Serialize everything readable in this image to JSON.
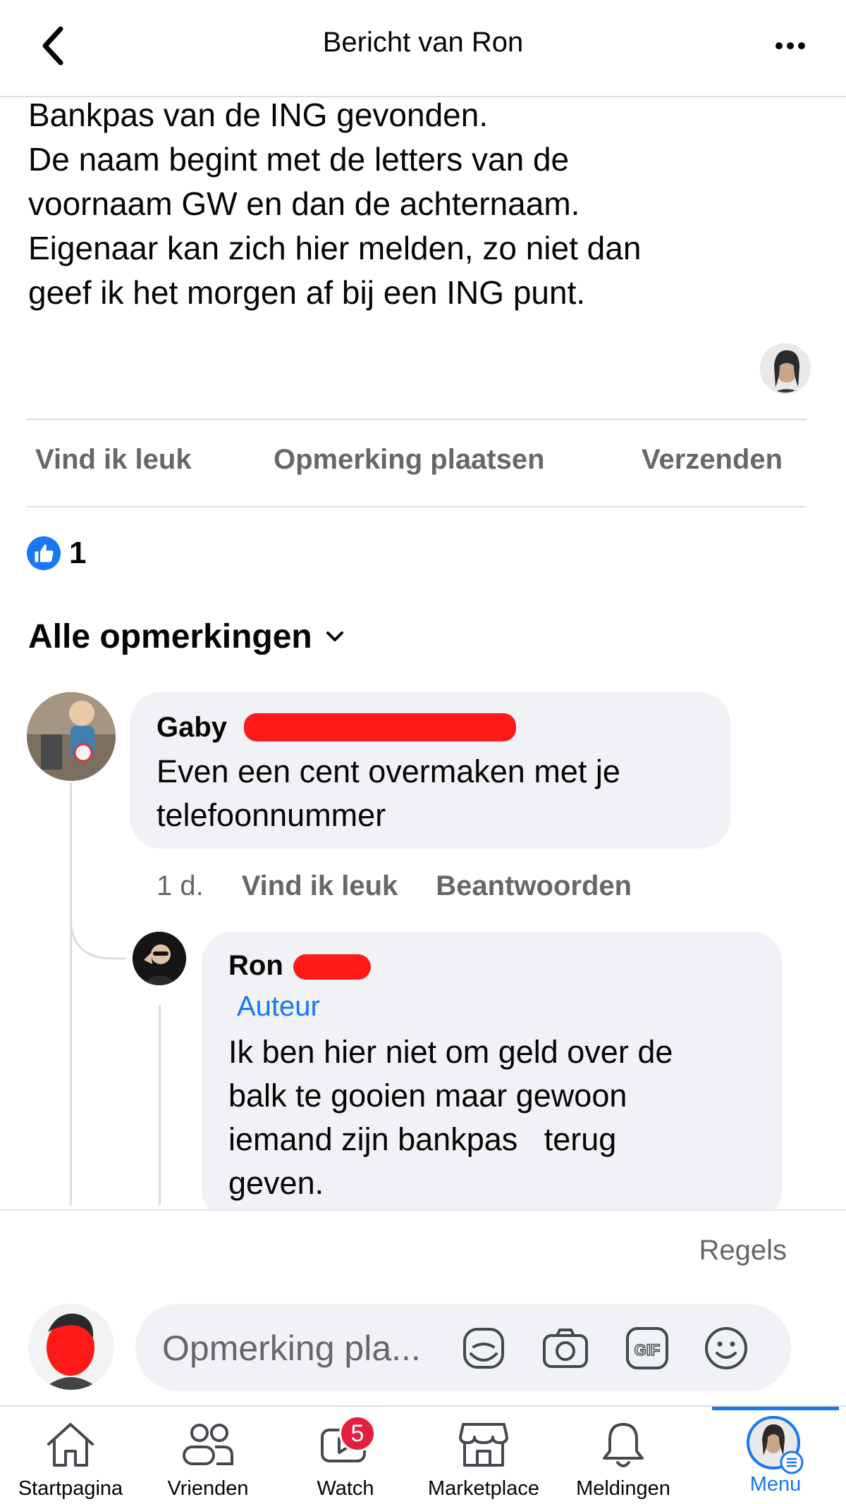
{
  "header": {
    "title": "Bericht van Ron"
  },
  "post": {
    "lines": [
      "Bankpas van de ING gevonden.",
      "De naam begint met de letters van de",
      "voornaam GW en dan de achternaam.",
      "Eigenaar kan zich hier melden, zo niet dan",
      "geef ik het morgen af bij een ING punt."
    ]
  },
  "actions": {
    "like": "Vind ik leuk",
    "comment": "Opmerking plaatsen",
    "share": "Verzenden"
  },
  "reactions": {
    "count": "1"
  },
  "comments_filter": {
    "label": "Alle opmerkingen"
  },
  "comments": [
    {
      "author": "Gaby",
      "text_lines": [
        "Even een cent overmaken met je",
        "telefoonnummer"
      ],
      "time": "1 d.",
      "like": "Vind ik leuk",
      "reply": "Beantwoorden"
    },
    {
      "author": "Ron",
      "badge": "Auteur",
      "text_lines": [
        "Ik ben hier niet om geld over de",
        "balk te gooien maar gewoon",
        "iemand zijn bankpas   terug",
        "geven."
      ]
    }
  ],
  "composer": {
    "rules": "Regels",
    "placeholder": "Opmerking pla..."
  },
  "tabs": [
    {
      "label": "Startpagina",
      "icon": "home-icon"
    },
    {
      "label": "Vrienden",
      "icon": "friends-icon"
    },
    {
      "label": "Watch",
      "icon": "watch-icon",
      "badge": "5"
    },
    {
      "label": "Marketplace",
      "icon": "marketplace-icon"
    },
    {
      "label": "Meldingen",
      "icon": "bell-icon"
    },
    {
      "label": "Menu",
      "icon": "menu-avatar-icon",
      "active": true
    }
  ],
  "colors": {
    "accent": "#1877f2",
    "badge": "#e41e3f",
    "redaction": "#ff1a1a"
  }
}
